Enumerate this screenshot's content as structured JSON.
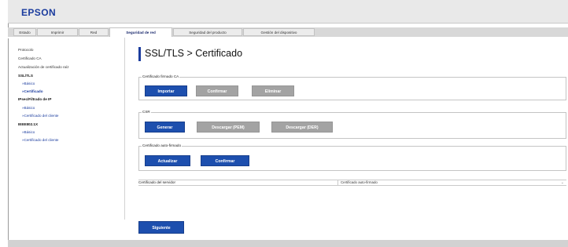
{
  "brand": {
    "logo": "EPSON"
  },
  "tabs": [
    {
      "label": "Estado"
    },
    {
      "label": "Imprimir"
    },
    {
      "label": "Red"
    },
    {
      "label": "Seguridad de red",
      "active": true
    },
    {
      "label": "Seguridad del producto"
    },
    {
      "label": "Gestión del dispositivo"
    }
  ],
  "sidebar": {
    "items": [
      {
        "label": "Protocolo"
      },
      {
        "label": "Certificado CA"
      },
      {
        "label": "Actualización de certificado raíz"
      },
      {
        "label": "SSL/TLS"
      },
      {
        "label": "»Básico"
      },
      {
        "label": "»Certificado"
      },
      {
        "label": "IPsec/Filtrado de IP"
      },
      {
        "label": "»Básico"
      },
      {
        "label": "»Certificado del cliente"
      },
      {
        "label": "IEEE802.1X"
      },
      {
        "label": "»Básico"
      },
      {
        "label": "»Certificado del cliente"
      }
    ]
  },
  "main": {
    "title": "SSL/TLS > Certificado",
    "sections": {
      "ca_signed": {
        "legend": "Certificado firmado CA",
        "buttons": {
          "import": "Importar",
          "confirm": "Confirmar",
          "delete": "Eliminar"
        }
      },
      "csr": {
        "legend": "CSR",
        "buttons": {
          "generate": "Generar",
          "download_pem": "Descargar (PEM)",
          "download_der": "Descargar (DER)"
        }
      },
      "self_signed": {
        "legend": "Certificado auto-firmado",
        "buttons": {
          "update": "Actualizar",
          "confirm": "Confirmar"
        }
      }
    },
    "server_cert": {
      "label": "Certificado del servidor",
      "value": "Certificado auto-firmado"
    },
    "next_button": "Siguiente"
  },
  "colors": {
    "brand": "#1b3c9e",
    "primary_button": "#1d4fae",
    "disabled_button": "#a3a3a3"
  }
}
